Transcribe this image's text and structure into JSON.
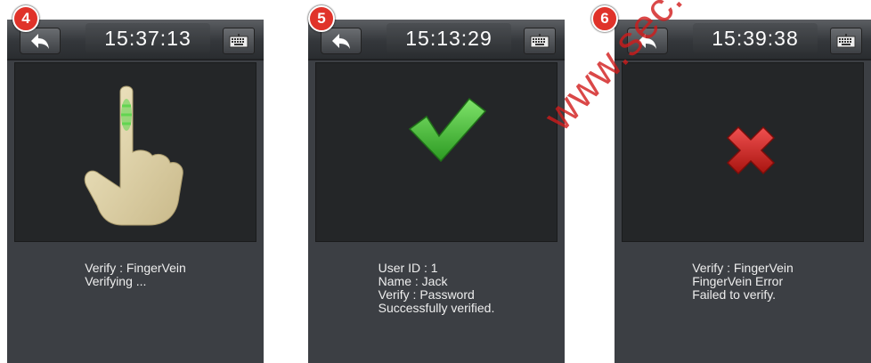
{
  "screens": [
    {
      "step": "4",
      "time": "15:37:13",
      "icon": "finger-pointing-icon",
      "messages": [
        "Verify : FingerVein",
        "Verifying ..."
      ]
    },
    {
      "step": "5",
      "time": "15:13:29",
      "icon": "check-mark-icon",
      "messages": [
        "User ID : 1",
        "Name : Jack",
        "Verify : Password",
        "Successfully verified."
      ]
    },
    {
      "step": "6",
      "time": "15:39:38",
      "icon": "x-mark-icon",
      "messages": [
        "Verify : FingerVein",
        "FingerVein Error",
        "Failed to verify."
      ]
    }
  ],
  "watermark": "www.sec.ua",
  "colors": {
    "screen_bg": "#3c3f44",
    "badge": "#e0332a",
    "check": "#4bc13a",
    "cross": "#d42020",
    "finger_scan": "#5ad64a"
  }
}
